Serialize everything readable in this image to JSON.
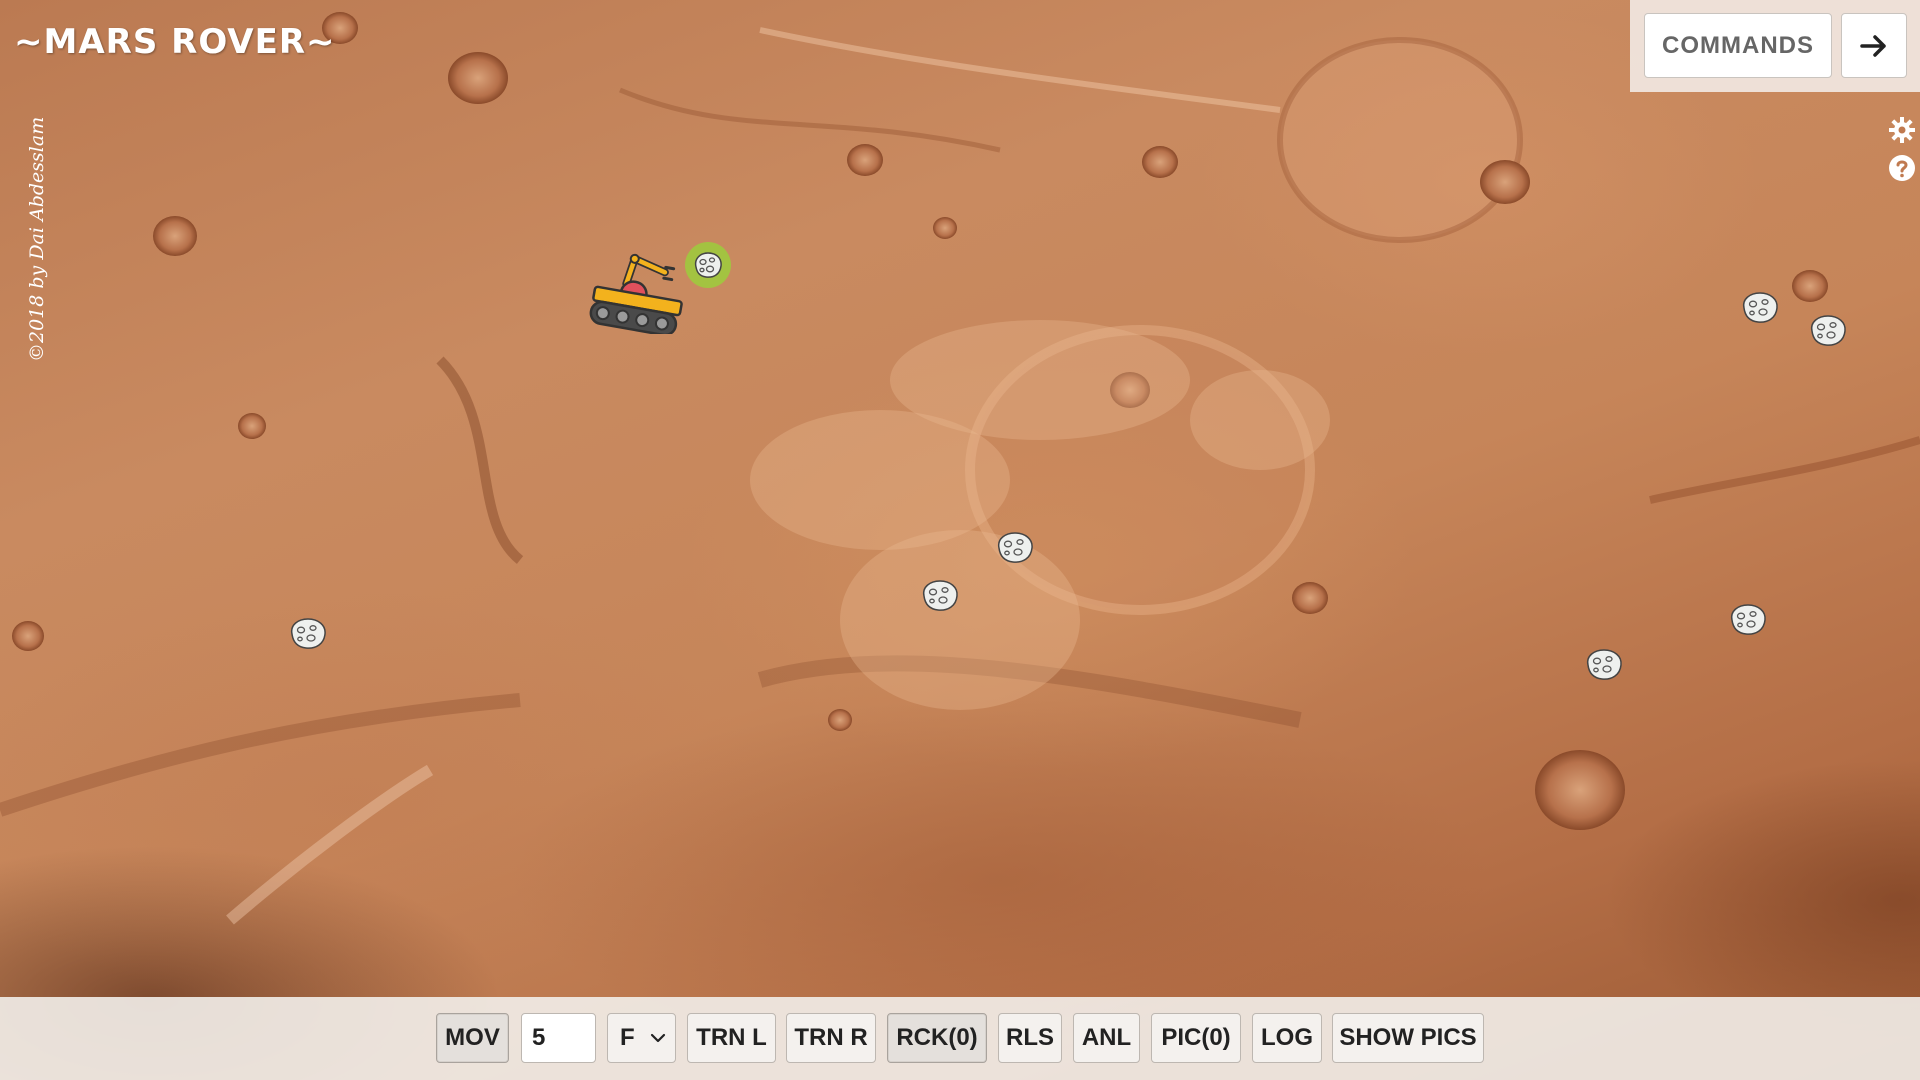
{
  "app": {
    "title": "~MARS ROVER~",
    "credit": "©2018 by Dai Abdesslam"
  },
  "header": {
    "commands_label": "COMMANDS",
    "arrow_label": "→"
  },
  "side_icons": [
    "gear-icon",
    "help-icon"
  ],
  "controls": {
    "mov_label": "MOV",
    "distance_value": "5",
    "direction_selected": "F",
    "turn_left_label": "TRN L",
    "turn_right_label": "TRN R",
    "rock_label": "RCK(0)",
    "release_label": "RLS",
    "analyze_label": "ANL",
    "picture_label": "PIC(0)",
    "log_label": "LOG",
    "show_pics_label": "SHOW PICS"
  },
  "rocks": {
    "total": 9,
    "highlighted": 1
  },
  "colors": {
    "rock_highlight": "#9ccc3c",
    "rover_body": "#f3b21d",
    "rover_dome": "#e0505c"
  }
}
